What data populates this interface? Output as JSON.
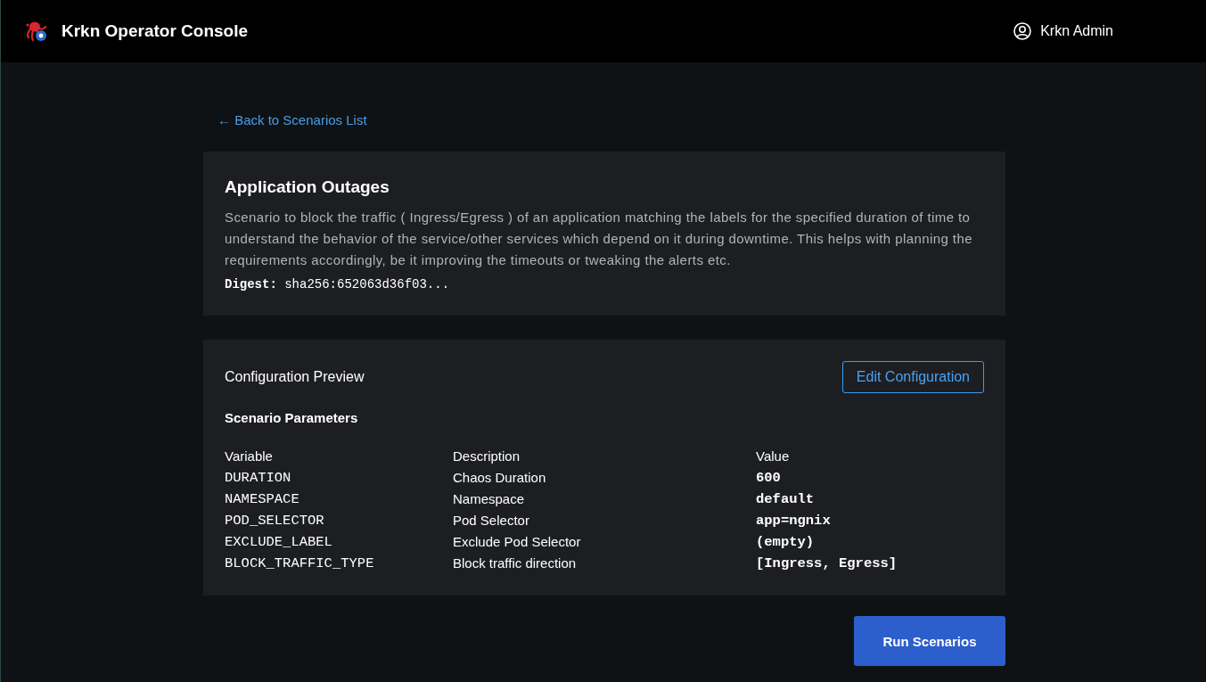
{
  "header": {
    "title": "Krkn Operator Console",
    "user": "Krkn Admin"
  },
  "back_link": "← Back to Scenarios List",
  "scenario": {
    "title": "Application Outages",
    "description": "Scenario to block the traffic ( Ingress/Egress ) of an application matching the labels for the specified duration of time to understand the behavior of the service/other services which depend on it during downtime. This helps with planning the requirements accordingly, be it improving the timeouts or tweaking the alerts etc.",
    "digest": "**Digest:** sha256:652063d36f03..."
  },
  "configuration": {
    "title": "Configuration Preview",
    "edit_button": "Edit Configuration",
    "parameters_title": "Scenario Parameters",
    "table": {
      "columns": [
        "Variable",
        "Description",
        "Value"
      ],
      "rows": [
        {
          "variable": "DURATION",
          "description": "Chaos Duration",
          "value": "600"
        },
        {
          "variable": "NAMESPACE",
          "description": "Namespace",
          "value": "default"
        },
        {
          "variable": "POD_SELECTOR",
          "description": "Pod Selector",
          "value": "app=ngnix"
        },
        {
          "variable": "EXCLUDE_LABEL",
          "description": "Exclude Pod Selector",
          "value": "(empty)"
        },
        {
          "variable": "BLOCK_TRAFFIC_TYPE",
          "description": "Block traffic direction",
          "value": "[Ingress, Egress]"
        }
      ]
    }
  },
  "run_button": "Run Scenarios"
}
